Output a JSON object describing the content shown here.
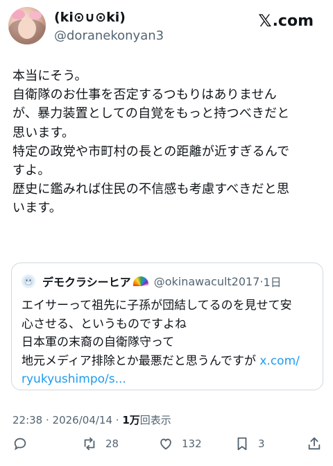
{
  "author": {
    "display_name": "(ki⊙∪⊙ki)",
    "handle": "@doranekonyan3"
  },
  "brand": {
    "label": ".com",
    "icon": "x-logo-icon"
  },
  "post": {
    "lines": [
      "本当にそう。",
      "自衛隊のお仕事を否定するつもりはありません",
      "が、暴力装置としての自覚をもっと持つべきだと",
      "思います。",
      "特定の政党や市町村の長との距離が近すぎるんで",
      "すよ。",
      "歴史に鑑みれば住民の不信感も考慮すべきだと思",
      "います。"
    ]
  },
  "quote": {
    "name": "デモクラシーヒア",
    "handle": "@okinawacult2017",
    "separator": "·",
    "time": "1日",
    "lines": [
      "エイサーって祖先に子孫が団結してるのを見せて安",
      "心させる、というものですよね",
      "日本軍の末裔の自衛隊守って"
    ],
    "line4_text": "地元メディア排除とか最悪だと思うんですが ",
    "link_part1": "x.com/",
    "link_part2": "ryukyushimpo/s..."
  },
  "meta": {
    "time": "22:38",
    "sep1": " · ",
    "date": "2026/04/14",
    "sep2": " · ",
    "views_count": "1万",
    "views_label": "回表示"
  },
  "actions": {
    "reposts": "28",
    "likes": "132",
    "bookmarks": "3"
  },
  "colors": {
    "link": "#1d9bf0",
    "muted": "#536471",
    "text": "#0f1419",
    "border": "#cfd9de"
  }
}
